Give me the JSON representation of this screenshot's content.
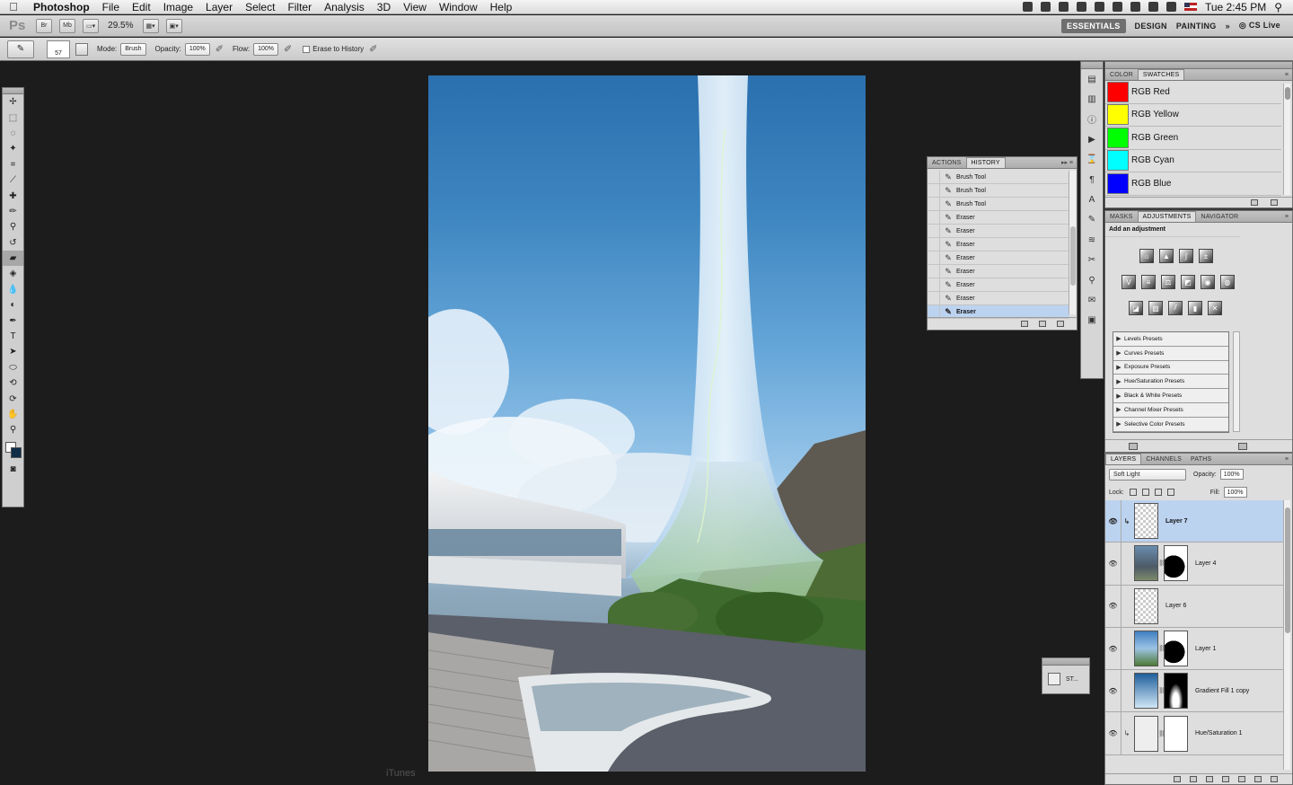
{
  "menubar": {
    "app_name": "Photoshop",
    "items": [
      "File",
      "Edit",
      "Image",
      "Layer",
      "Select",
      "Filter",
      "Analysis",
      "3D",
      "View",
      "Window",
      "Help"
    ],
    "clock": "Tue 2:45 PM"
  },
  "appbar": {
    "ps_logo": "Ps",
    "bridge_label": "Br",
    "minibridge_label": "Mb",
    "zoom": "29.5%",
    "workspaces": [
      "ESSENTIALS",
      "DESIGN",
      "PAINTING"
    ],
    "more": "»",
    "cslive": "CS Live"
  },
  "options": {
    "brush_size": "57",
    "mode_label": "Mode:",
    "mode_value": "Brush",
    "opacity_label": "Opacity:",
    "opacity_value": "100%",
    "flow_label": "Flow:",
    "flow_value": "100%",
    "erase_history_label": "Erase to History"
  },
  "history": {
    "tabs": [
      "ACTIONS",
      "HISTORY"
    ],
    "items": [
      "Brush Tool",
      "Brush Tool",
      "Brush Tool",
      "Eraser",
      "Eraser",
      "Eraser",
      "Eraser",
      "Eraser",
      "Eraser",
      "Eraser",
      "Eraser"
    ],
    "selected_index": 10
  },
  "mini_panel": {
    "label": "ST..."
  },
  "watermark": "iTunes",
  "swatches": {
    "tabs": [
      "COLOR",
      "SWATCHES"
    ],
    "items": [
      {
        "name": "RGB Red",
        "color": "#ff0000"
      },
      {
        "name": "RGB Yellow",
        "color": "#ffff00"
      },
      {
        "name": "RGB Green",
        "color": "#00ff00"
      },
      {
        "name": "RGB Cyan",
        "color": "#00ffff"
      },
      {
        "name": "RGB Blue",
        "color": "#0000ff"
      }
    ]
  },
  "adjustments": {
    "tabs": [
      "MASKS",
      "ADJUSTMENTS",
      "NAVIGATOR"
    ],
    "title": "Add an adjustment",
    "presets": [
      "Levels Presets",
      "Curves Presets",
      "Exposure Presets",
      "Hue/Saturation Presets",
      "Black & White Presets",
      "Channel Mixer Presets",
      "Selective Color Presets"
    ]
  },
  "layers": {
    "tabs": [
      "LAYERS",
      "CHANNELS",
      "PATHS"
    ],
    "blend_mode": "Soft Light",
    "opacity_label": "Opacity:",
    "opacity_value": "100%",
    "lock_label": "Lock:",
    "fill_label": "Fill:",
    "fill_value": "100%",
    "items": [
      {
        "name": "Layer 7",
        "selected": true
      },
      {
        "name": "Layer 4",
        "selected": false
      },
      {
        "name": "Layer 6",
        "selected": false
      },
      {
        "name": "Layer 1",
        "selected": false
      },
      {
        "name": "Gradient Fill 1 copy",
        "selected": false
      },
      {
        "name": "Hue/Saturation 1",
        "selected": false
      }
    ]
  },
  "colors": {
    "selection": "#bcd3f0",
    "background_color": "#0f2d47",
    "foreground_color": "#ffffff"
  }
}
